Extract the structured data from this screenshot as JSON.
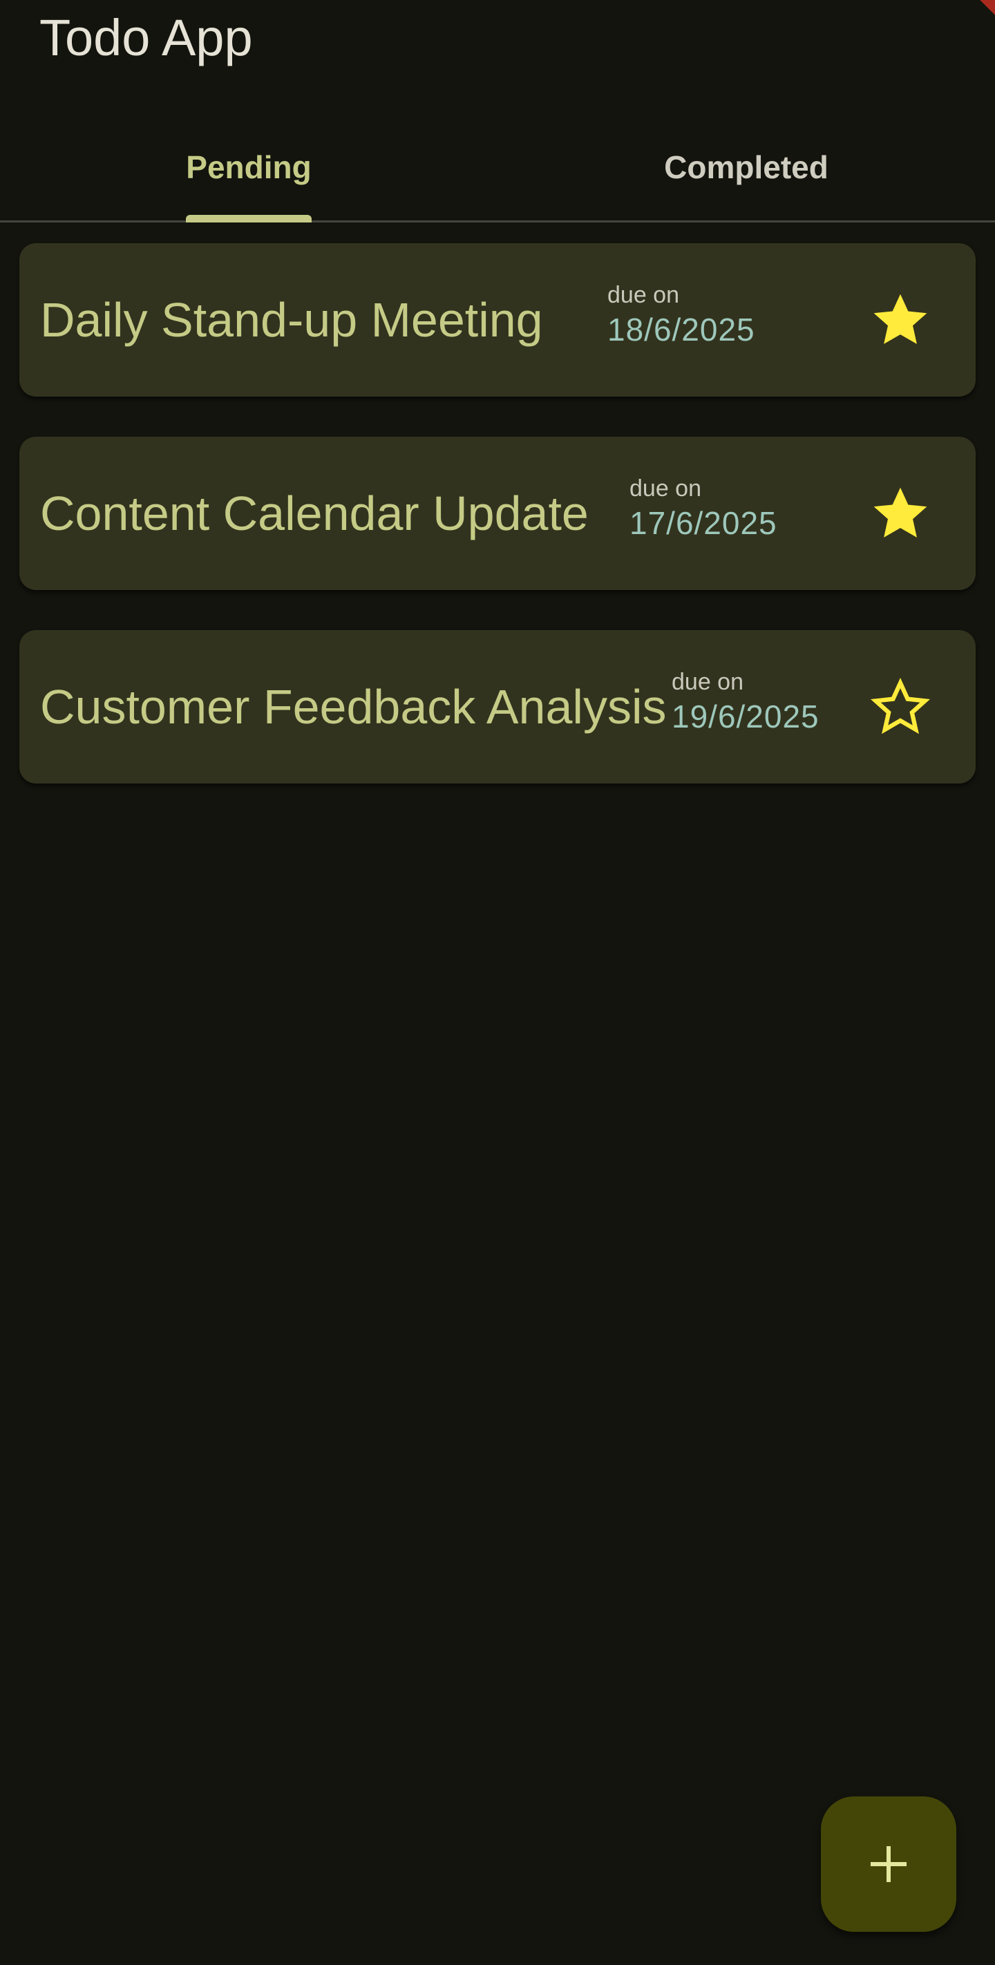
{
  "app": {
    "title": "Todo App"
  },
  "tabs": [
    {
      "label": "Pending",
      "active": true
    },
    {
      "label": "Completed",
      "active": false
    }
  ],
  "todos": [
    {
      "title": "Daily Stand-up Meeting",
      "due_label": "due on",
      "due_date": "18/6/2025",
      "starred": true
    },
    {
      "title": "Content Calendar Update",
      "due_label": "due on",
      "due_date": "17/6/2025",
      "starred": true
    },
    {
      "title": "Customer Feedback Analysis",
      "due_label": "due on",
      "due_date": "19/6/2025",
      "starred": false
    }
  ],
  "icons": {
    "star_filled": "star-filled-icon",
    "star_outline": "star-outline-icon",
    "add": "plus-icon"
  },
  "colors": {
    "background": "#13140e",
    "accent": "#c5cb86",
    "card": "#32331e",
    "star": "#ffeb3b",
    "fab": "#444607",
    "due_date": "#9ec8bc"
  }
}
